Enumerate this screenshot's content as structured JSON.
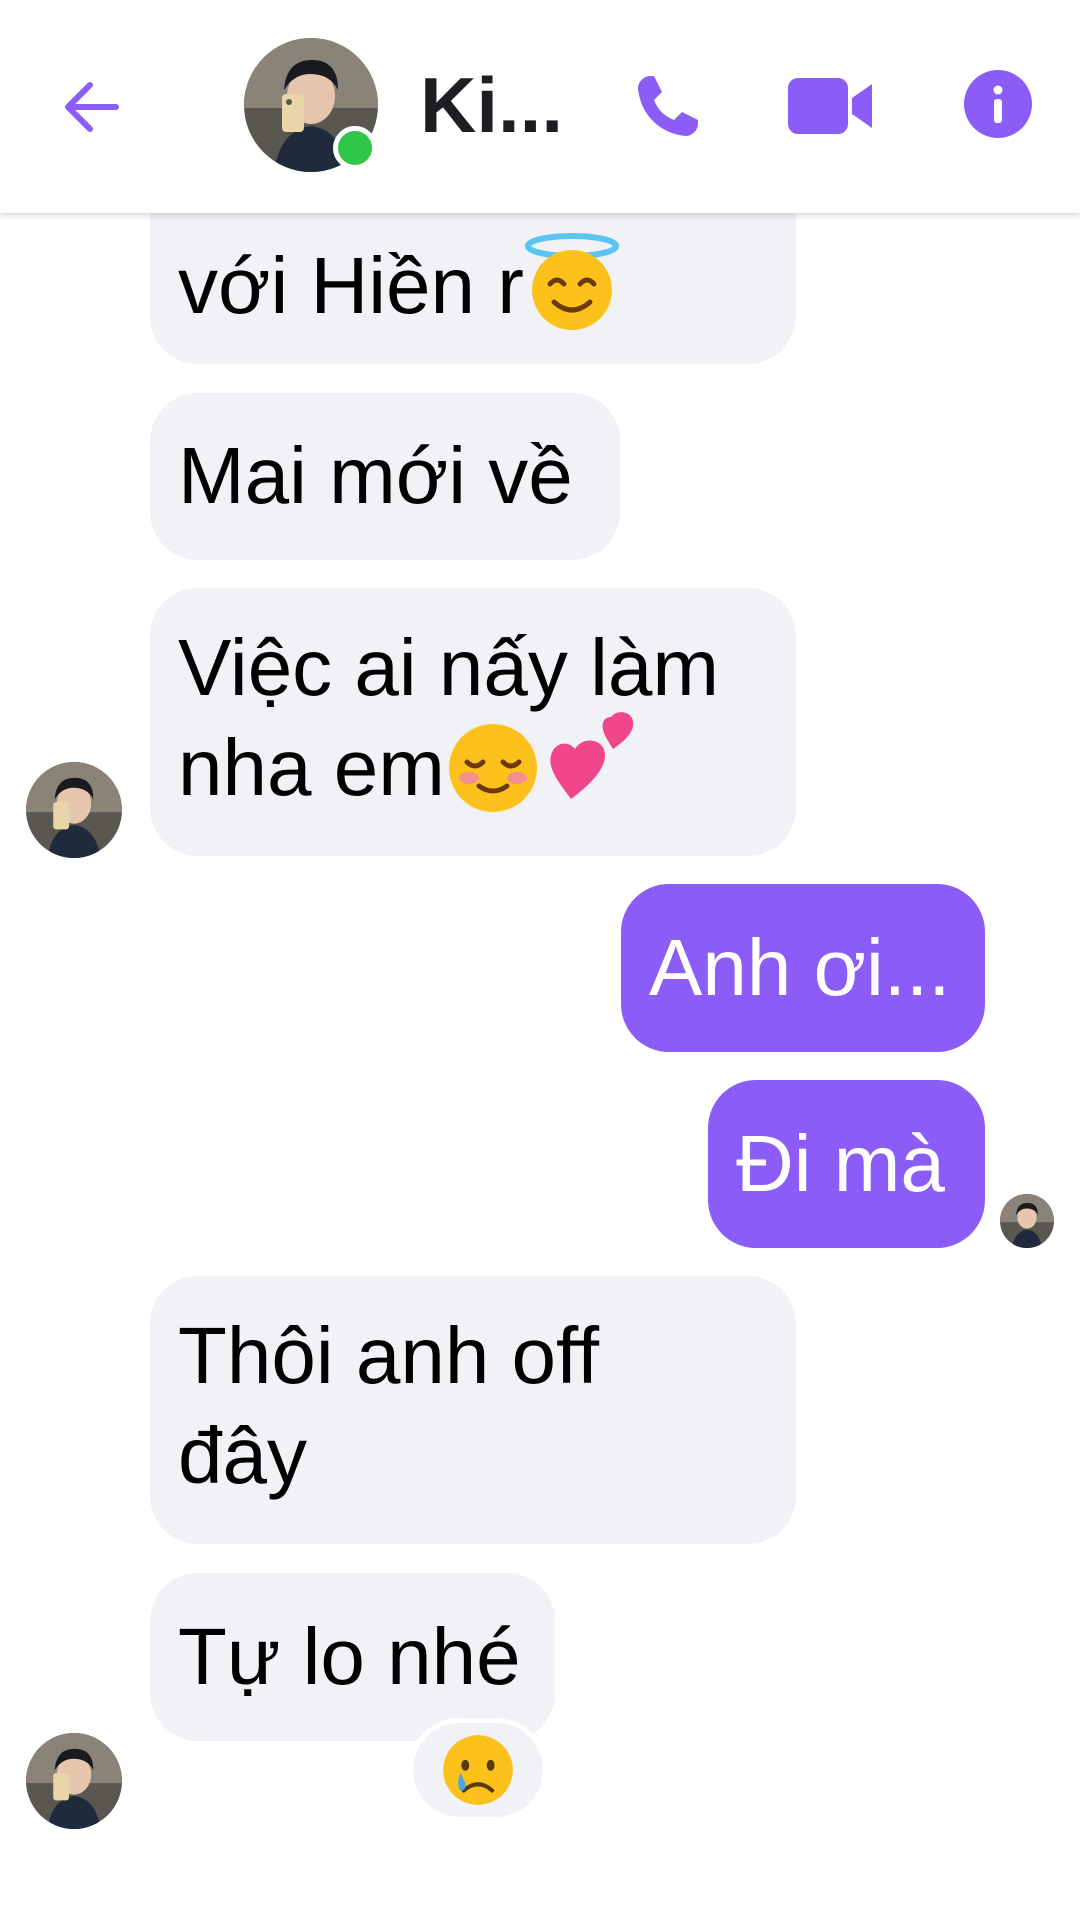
{
  "header": {
    "contact_name": "Ki...",
    "online": true,
    "icons": {
      "back": "back-arrow-icon",
      "call": "phone-icon",
      "video": "video-camera-icon",
      "info": "info-icon"
    }
  },
  "colors": {
    "accent": "#8b5cf6",
    "incoming_bubble": "#f1f2f6",
    "online": "#31c54a"
  },
  "messages": [
    {
      "id": "m1",
      "direction": "incoming",
      "text": "với Hiền r",
      "emoji": [
        "smiling-face-with-halo"
      ]
    },
    {
      "id": "m2",
      "direction": "incoming",
      "text": "Mai mới về"
    },
    {
      "id": "m3",
      "direction": "incoming",
      "line1": "Việc ai nấy làm",
      "line2": "nha em",
      "emoji": [
        "smiling-face-blush",
        "two-hearts"
      ]
    },
    {
      "id": "m4",
      "direction": "outgoing",
      "text": "Anh ơi..."
    },
    {
      "id": "m5",
      "direction": "outgoing",
      "text": "Đi mà"
    },
    {
      "id": "m6",
      "direction": "incoming",
      "line1": "Thôi anh off",
      "line2": "đây"
    },
    {
      "id": "m7",
      "direction": "incoming",
      "text": "Tự lo nhé",
      "reaction": "crying-face"
    }
  ]
}
